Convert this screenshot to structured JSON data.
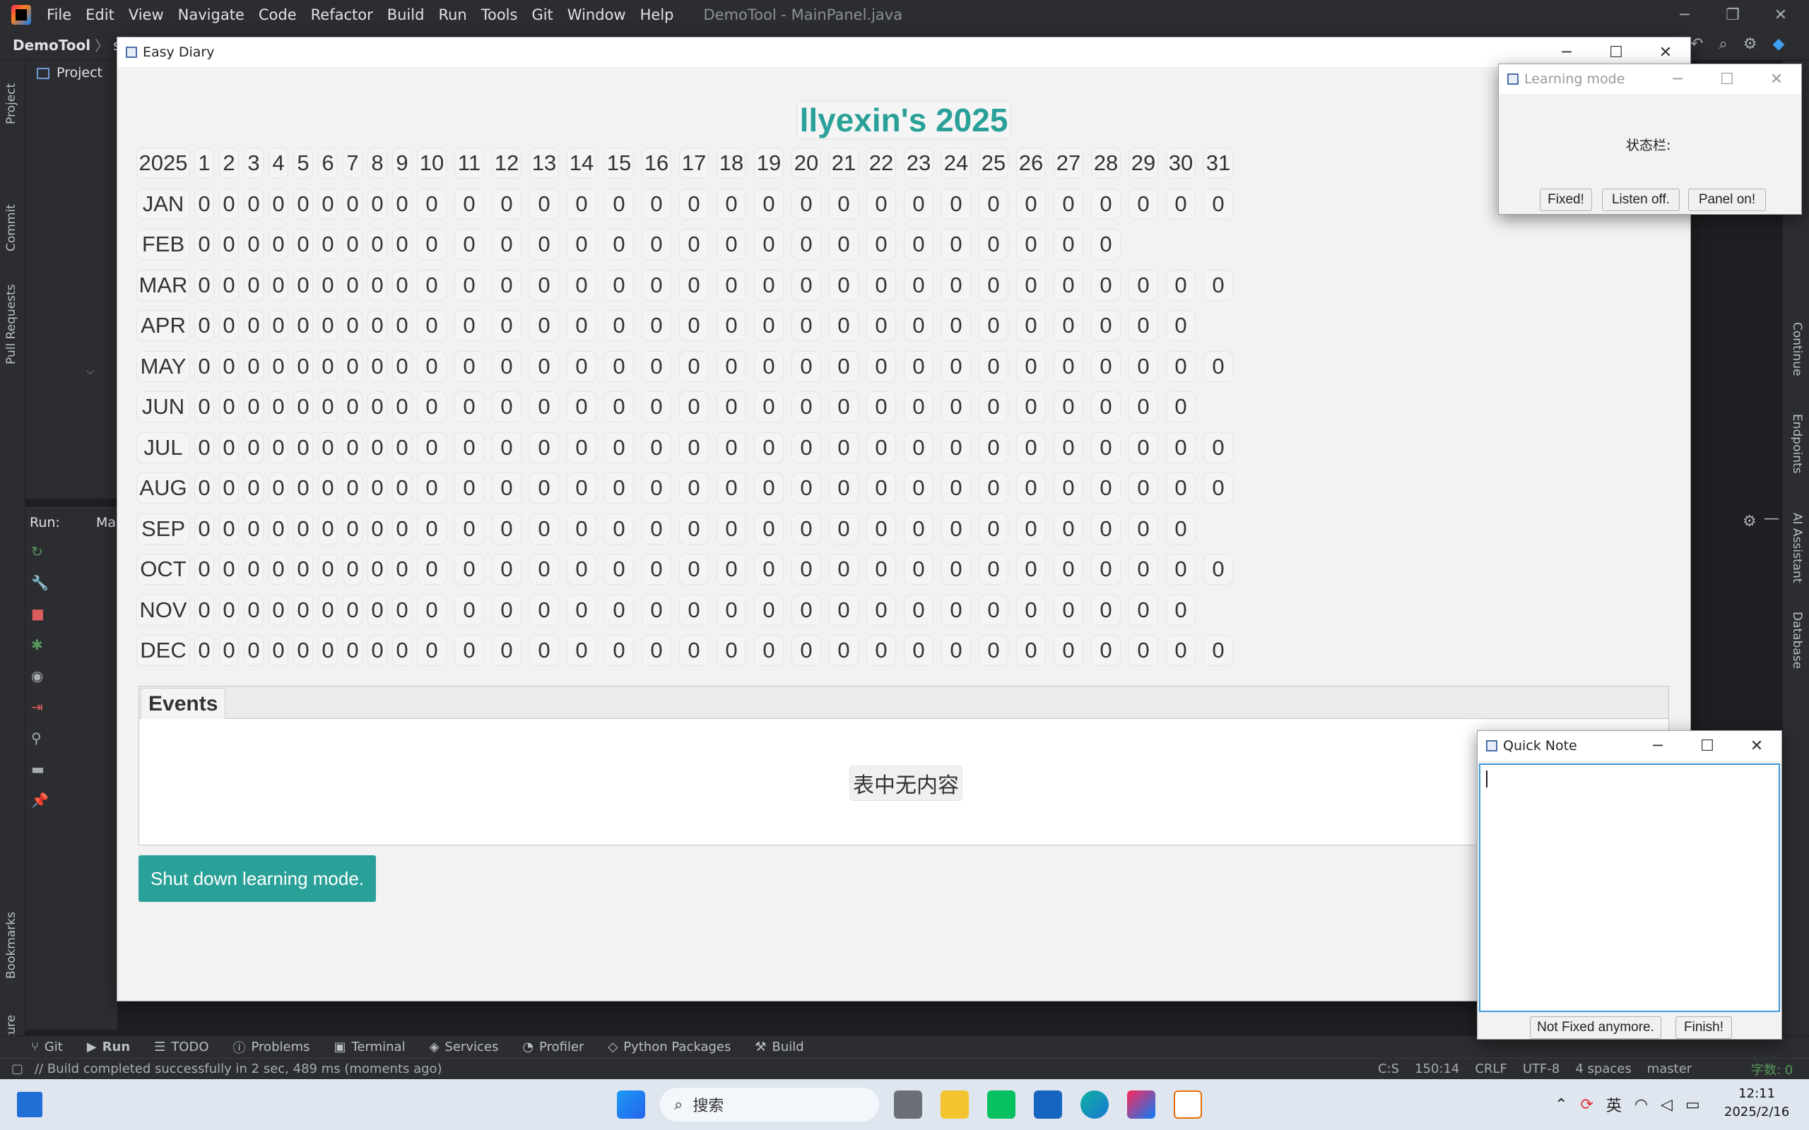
{
  "ide": {
    "menu": [
      "File",
      "Edit",
      "View",
      "Navigate",
      "Code",
      "Refactor",
      "Build",
      "Run",
      "Tools",
      "Git",
      "Window",
      "Help"
    ],
    "window_title": "DemoTool - MainPanel.java",
    "nav_project": "DemoTool",
    "nav_src": "src",
    "project_label": "Project",
    "left_tools": [
      "Project",
      "Commit",
      "Pull Requests",
      "Bookmarks",
      "Structure"
    ],
    "right_tools": [
      "Continue",
      "Endpoints",
      "AI Assistant",
      "Database"
    ],
    "run_label": "Run:",
    "run_tab": "Ma",
    "bottom_tabs": [
      "Git",
      "Run",
      "TODO",
      "Problems",
      "Terminal",
      "Services",
      "Profiler",
      "Python Packages",
      "Build"
    ],
    "status_message": "// Build completed successfully in 2 sec, 489 ms (moments ago)",
    "status_right": [
      "C:S",
      "150:14",
      "CRLF",
      "UTF-8",
      "4 spaces",
      "master"
    ],
    "status_extra": "字数: 0"
  },
  "diary": {
    "window_title": "Easy Diary",
    "heading": "llyexin's 2025",
    "year": "2025",
    "months": [
      {
        "name": "JAN",
        "days": 31
      },
      {
        "name": "FEB",
        "days": 28
      },
      {
        "name": "MAR",
        "days": 31
      },
      {
        "name": "APR",
        "days": 30
      },
      {
        "name": "MAY",
        "days": 31
      },
      {
        "name": "JUN",
        "days": 30
      },
      {
        "name": "JUL",
        "days": 31
      },
      {
        "name": "AUG",
        "days": 31
      },
      {
        "name": "SEP",
        "days": 30
      },
      {
        "name": "OCT",
        "days": 31
      },
      {
        "name": "NOV",
        "days": 30
      },
      {
        "name": "DEC",
        "days": 31
      }
    ],
    "cell_value": "0",
    "events_tab": "Events",
    "empty_table": "表中无内容",
    "shutdown_button": "Shut down learning mode."
  },
  "learning": {
    "window_title": "Learning mode",
    "status_label": "状态栏:",
    "buttons": [
      "Fixed!",
      "Listen off.",
      "Panel on!"
    ]
  },
  "quicknote": {
    "window_title": "Quick Note",
    "buttons": [
      "Not Fixed anymore.",
      "Finish!"
    ]
  },
  "taskbar": {
    "search_placeholder": "搜索",
    "ime": "英",
    "time": "12:11",
    "date": "2025/2/16"
  }
}
